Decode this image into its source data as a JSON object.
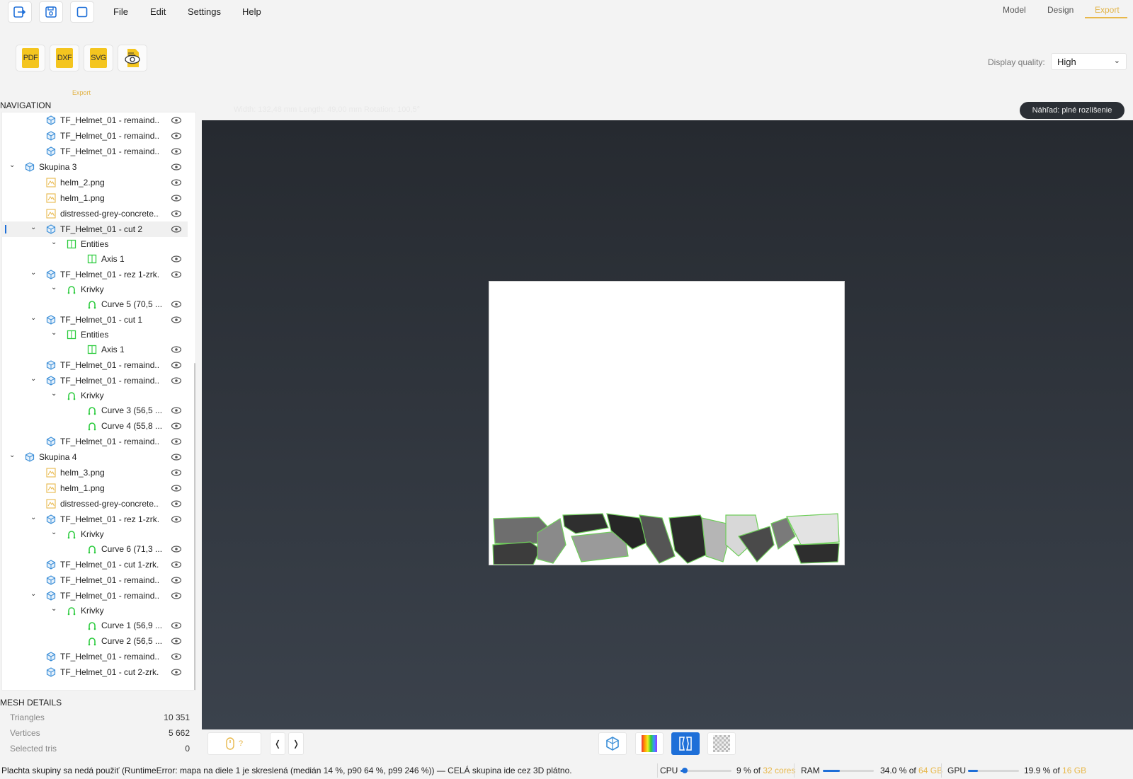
{
  "menu": {
    "file": "File",
    "edit": "Edit",
    "settings": "Settings",
    "help": "Help"
  },
  "modes": {
    "model": "Model",
    "design": "Design",
    "export": "Export"
  },
  "export_buttons": {
    "pdf": "PDF",
    "dxf": "DXF",
    "svg": "SVG",
    "caption": "Export"
  },
  "display_quality": {
    "label": "Display quality:",
    "value": "High"
  },
  "navigation": {
    "title": "NAVIGATION",
    "rows": [
      {
        "label": "TF_Helmet_01 - remaind..."
      },
      {
        "label": "TF_Helmet_01 - remaind..."
      },
      {
        "label": "TF_Helmet_01 - remaind..."
      },
      {
        "label": "Skupina 3"
      },
      {
        "label": "helm_2.png"
      },
      {
        "label": "helm_1.png"
      },
      {
        "label": "distressed-grey-concrete..."
      },
      {
        "label": "TF_Helmet_01 - cut 2"
      },
      {
        "label": "Entities"
      },
      {
        "label": "Axis 1"
      },
      {
        "label": "TF_Helmet_01 - rez 1-zrk..."
      },
      {
        "label": "Krivky"
      },
      {
        "label": "Curve 5  (70,5 ..."
      },
      {
        "label": "TF_Helmet_01 - cut 1"
      },
      {
        "label": "Entities"
      },
      {
        "label": "Axis 1"
      },
      {
        "label": "TF_Helmet_01 - remaind..."
      },
      {
        "label": "TF_Helmet_01 - remaind..."
      },
      {
        "label": "Krivky"
      },
      {
        "label": "Curve 3  (56,5 ..."
      },
      {
        "label": "Curve 4  (55,8 ..."
      },
      {
        "label": "TF_Helmet_01 - remaind..."
      },
      {
        "label": "Skupina 4"
      },
      {
        "label": "helm_3.png"
      },
      {
        "label": "helm_1.png"
      },
      {
        "label": "distressed-grey-concrete..."
      },
      {
        "label": "TF_Helmet_01 - rez 1-zrk..."
      },
      {
        "label": "Krivky"
      },
      {
        "label": "Curve 6  (71,3 ..."
      },
      {
        "label": "TF_Helmet_01 - cut 1-zrk..."
      },
      {
        "label": "TF_Helmet_01 - remaind..."
      },
      {
        "label": "TF_Helmet_01 - remaind..."
      },
      {
        "label": "Krivky"
      },
      {
        "label": "Curve 1  (56,9 ..."
      },
      {
        "label": "Curve 2  (56,5 ..."
      },
      {
        "label": "TF_Helmet_01 - remaind..."
      },
      {
        "label": "TF_Helmet_01 - cut 2-zrk..."
      }
    ]
  },
  "mesh_details": {
    "title": "MESH DETAILS",
    "triangles_label": "Triangles",
    "triangles": "10 351",
    "vertices_label": "Vertices",
    "vertices": "5 662",
    "selected_label": "Selected tris",
    "selected": "0"
  },
  "viewport": {
    "dims": "Width: 132,48 mm   Length: 49,00 mm   Rotation: 100,5°",
    "preview_label": "Náhľad: plné rozlíšenie"
  },
  "bottom": {
    "mouse_hint": "?",
    "prev": "❬",
    "next": "❭"
  },
  "status": {
    "message": "Plachta skupiny sa nedá použiť (RuntimeError: mapa na diele 1 je skreslená (medián 14 %, p90 64 %, p99 246 %)) — CELÁ skupina ide cez 3D plátno.",
    "cpu_label": "CPU",
    "cpu_value": "9 % of",
    "cpu_total": "32 cores",
    "cpu_fraction": 0.09,
    "ram_label": "RAM",
    "ram_value": "34.0 % of",
    "ram_total": "64 GB",
    "ram_fraction": 0.34,
    "gpu_label": "GPU",
    "gpu_value": "19.9 % of",
    "gpu_total": "16 GB",
    "gpu_fraction": 0.199
  },
  "colors": {
    "accent": "#e8b84b",
    "blue": "#1e6fd8",
    "green": "#2ecc40",
    "mesh": "#3c8fd8",
    "file_yellow": "#f4c51f"
  }
}
